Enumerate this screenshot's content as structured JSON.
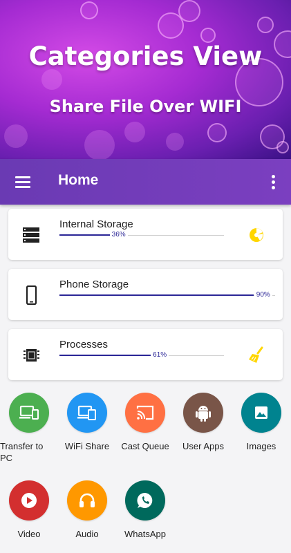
{
  "banner": {
    "title": "Categories View",
    "subtitle": "Share File Over WIFI"
  },
  "appbar": {
    "title": "Home",
    "menu_icon": "hamburger-menu-icon",
    "more_icon": "more-vert-icon"
  },
  "storage": [
    {
      "label": "Internal Storage",
      "percent_text": "36%",
      "fraction": 0.36,
      "icon": "server-icon",
      "action_icon": "pie-chart-icon"
    },
    {
      "label": "Phone Storage",
      "percent_text": "90%",
      "fraction": 0.9,
      "icon": "phone-icon",
      "action_icon": ""
    },
    {
      "label": "Processes",
      "percent_text": "61%",
      "fraction": 0.61,
      "icon": "chip-icon",
      "action_icon": "broom-icon"
    }
  ],
  "categories": [
    {
      "label": "Transfer to PC",
      "color": "#4caf50",
      "icon": "devices-icon"
    },
    {
      "label": "WiFi Share",
      "color": "#2196f3",
      "icon": "device-share-icon"
    },
    {
      "label": "Cast Queue",
      "color": "#ff7043",
      "icon": "cast-icon"
    },
    {
      "label": "User Apps",
      "color": "#795548",
      "icon": "android-icon"
    },
    {
      "label": "Images",
      "color": "#00838f",
      "icon": "image-icon"
    },
    {
      "label": "Video",
      "color": "#d32f2f",
      "icon": "play-circle-icon"
    },
    {
      "label": "Audio",
      "color": "#ff9800",
      "icon": "headphones-icon"
    },
    {
      "label": "WhatsApp",
      "color": "#00695c",
      "icon": "whatsapp-icon"
    }
  ],
  "colors": {
    "appbar": "#6a3ab3",
    "progress": "#2a2596",
    "accent_yellow": "#ffd600"
  }
}
